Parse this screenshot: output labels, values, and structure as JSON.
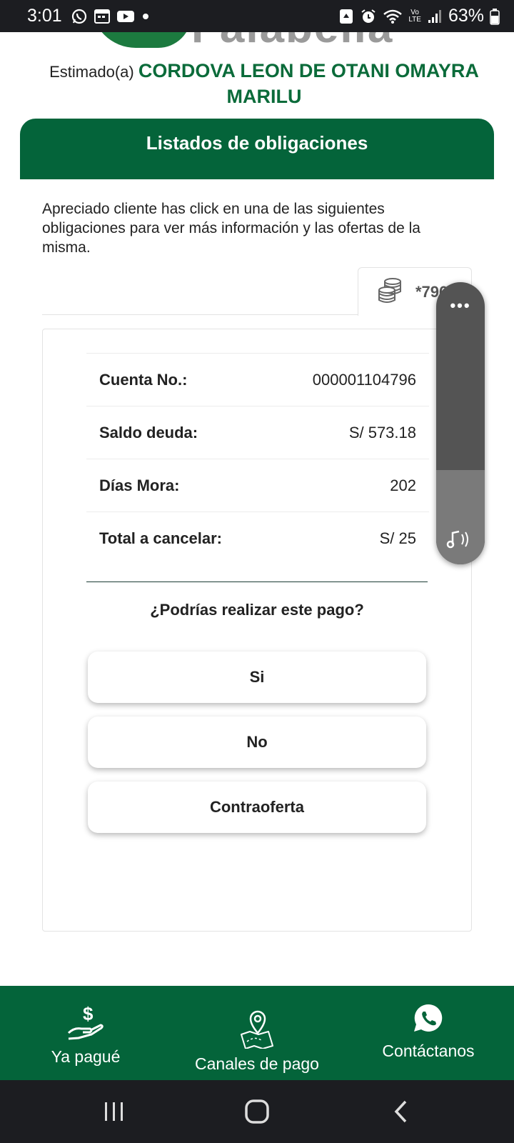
{
  "status_bar": {
    "time": "3:01",
    "battery": "63%",
    "icons": [
      "whatsapp-icon",
      "calendar-icon",
      "youtube-icon",
      "dot-icon",
      "recycle-icon",
      "alarm-icon",
      "wifi-icon",
      "volte-icon",
      "signal-icon",
      "battery-icon"
    ],
    "volte_top": "Vo",
    "volte_bottom": "LTE"
  },
  "brand": {
    "logo_text": "Falabella",
    "color": "#04643a"
  },
  "greeting": {
    "label": "Estimado(a)",
    "name": "CORDOVA LEON DE OTANI OMAYRA MARILU"
  },
  "header": {
    "title": "Listados de obligaciones"
  },
  "intro": "Apreciado cliente has click en una de las siguientes obligaciones para ver más información y las ofertas de la misma.",
  "tabs": [
    {
      "label": "*796",
      "icon": "coins-icon"
    }
  ],
  "obligation": {
    "rows": [
      {
        "label": "Cuenta No.:",
        "value": "000001104796"
      },
      {
        "label": "Saldo deuda:",
        "value": "S/ 573.18"
      },
      {
        "label": "Días Mora:",
        "value": "202"
      },
      {
        "label": "Total a cancelar:",
        "value": "S/ 25"
      }
    ],
    "question": "¿Podrías realizar este pago?",
    "buttons": [
      "Si",
      "No",
      "Contraoferta"
    ]
  },
  "floating_panel": {
    "menu_icon": "more-dots-icon",
    "dots": "•••",
    "bottom_icon": "music-note-icon"
  },
  "bottom_nav": [
    {
      "label": "Ya pagué",
      "icon": "hand-dollar-icon"
    },
    {
      "label": "Canales de pago",
      "icon": "map-pin-icon"
    },
    {
      "label": "Contáctanos",
      "icon": "whatsapp-icon"
    }
  ],
  "system_nav": [
    "recent-apps-icon",
    "home-icon",
    "back-icon"
  ]
}
